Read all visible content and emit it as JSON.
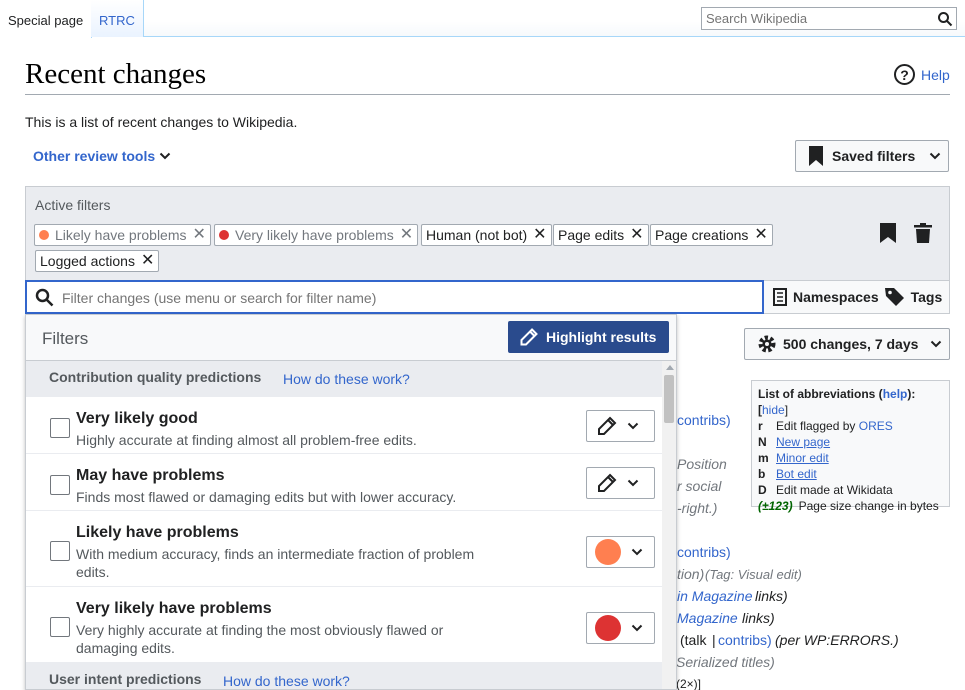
{
  "tabs": [
    {
      "label": "Special page"
    },
    {
      "label": "RTRC"
    }
  ],
  "search": {
    "placeholder": "Search Wikipedia"
  },
  "header": {
    "title": "Recent changes",
    "help": "Help",
    "intro": "This is a list of recent changes to Wikipedia.",
    "review_tools": "Other review tools"
  },
  "saved_filters": "Saved filters",
  "active_filters": {
    "label": "Active filters",
    "tags": [
      {
        "label": "Likely have problems",
        "color": "#ff7f50",
        "dim": true
      },
      {
        "label": "Very likely have problems",
        "color": "#dd3333",
        "dim": true
      },
      {
        "label": "Human (not bot)"
      },
      {
        "label": "Page edits"
      },
      {
        "label": "Page creations"
      },
      {
        "label": "Logged actions"
      }
    ]
  },
  "filter_input": {
    "placeholder": "Filter changes (use menu or search for filter name)"
  },
  "namespaces": "Namespaces",
  "tags_label": "Tags",
  "dropdown": {
    "title": "Filters",
    "highlight_button": "Highlight results",
    "groups": [
      {
        "title": "Contribution quality predictions",
        "link": "How do these work?"
      },
      {
        "title": "User intent predictions",
        "link": "How do these work?"
      }
    ],
    "rows": [
      {
        "title": "Very likely good",
        "desc": "Highly accurate at finding almost all problem-free edits.",
        "highlight": "none"
      },
      {
        "title": "May have problems",
        "desc": "Finds most flawed or damaging edits but with lower accuracy.",
        "highlight": "none"
      },
      {
        "title": "Likely have problems",
        "desc": "With medium accuracy, finds an intermediate fraction of problem edits.",
        "highlight": "#ff7f50"
      },
      {
        "title": "Very likely have problems",
        "desc": "Very highly accurate at finding the most obviously flawed or damaging edits.",
        "highlight": "#dd3333"
      }
    ]
  },
  "changes_button": "500 changes, 7 days",
  "abbreviations": {
    "title": "List of abbreviations (",
    "help": "help",
    "close": "):[",
    "hide": "hide",
    "end": "]",
    "items": [
      {
        "k": "r",
        "v": "Edit flagged by ",
        "link": "ORES"
      },
      {
        "k": "N",
        "v": "",
        "link": "New page"
      },
      {
        "k": "m",
        "v": "",
        "link": "Minor edit"
      },
      {
        "k": "b",
        "v": "",
        "link": "Bot edit"
      },
      {
        "k": "D",
        "v": "Edit made at Wikidata",
        "link": ""
      }
    ],
    "size_key": "(±123)",
    "size_desc": "Page size change in bytes"
  },
  "background_fragments": [
    "contribs)",
    "Position",
    "r social",
    "-right.)",
    "contribs)",
    "tion)",
    "(Tag: Visual edit)",
    "in Magazine",
    "links)",
    "Magazine",
    "links)",
    "(talk",
    "|",
    "contribs)",
    "(per WP:ERRORS.)",
    "Serialized titles)",
    "(2×)]"
  ]
}
